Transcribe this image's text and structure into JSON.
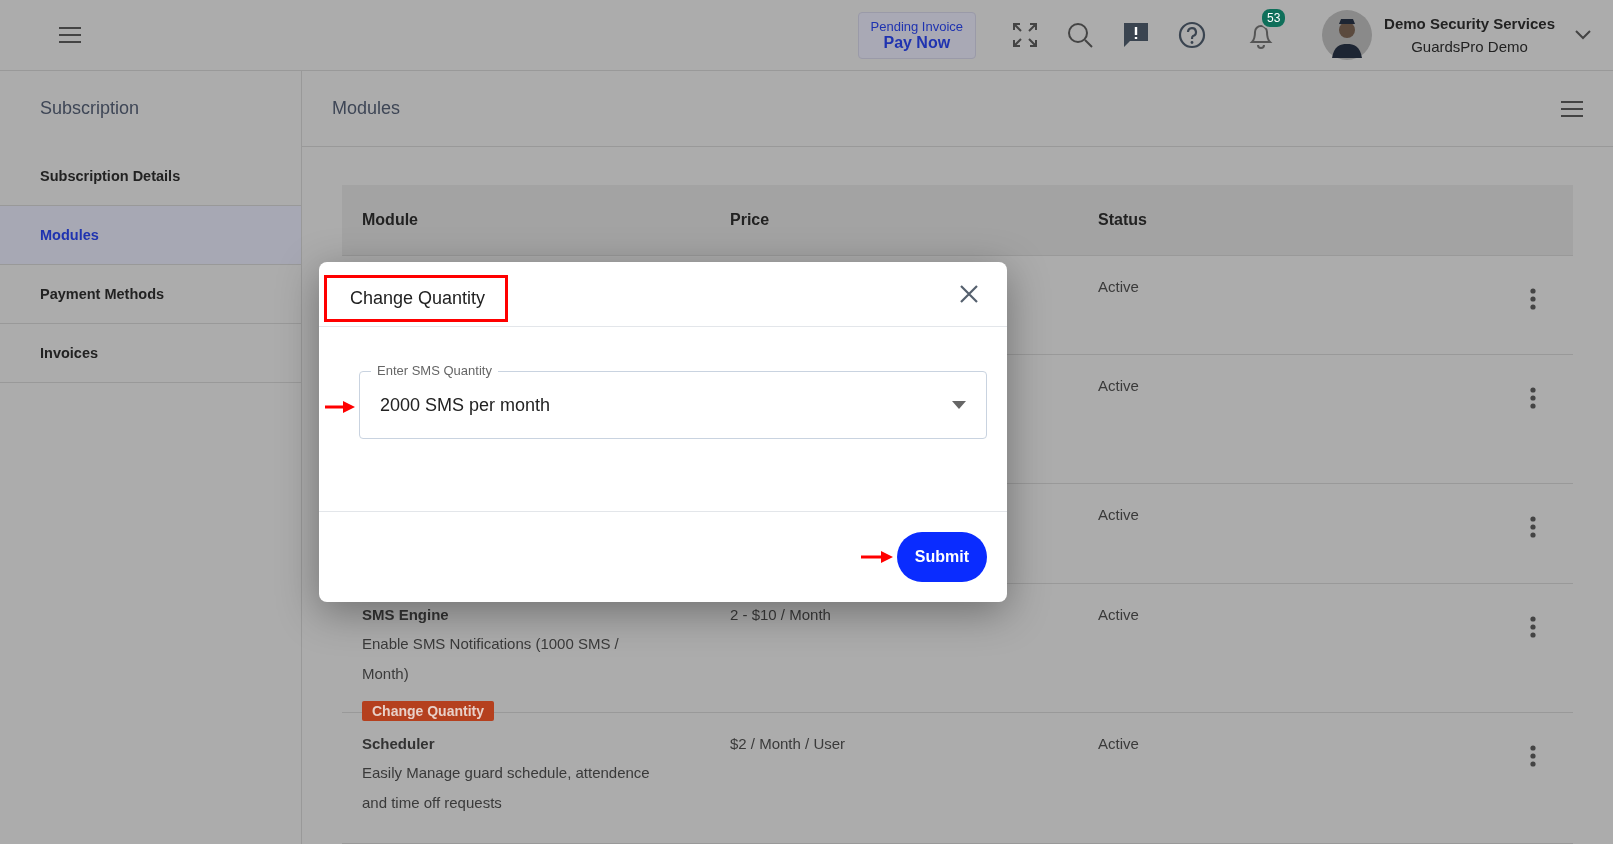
{
  "topbar": {
    "pending_invoice": {
      "label": "Pending Invoice",
      "action": "Pay Now"
    },
    "notification_count": "53",
    "user": {
      "name": "Demo Security Services",
      "company": "GuardsPro Demo"
    }
  },
  "sidebar": {
    "title": "Subscription",
    "items": [
      {
        "label": "Subscription Details",
        "selected": false
      },
      {
        "label": "Modules",
        "selected": true
      },
      {
        "label": "Payment Methods",
        "selected": false
      },
      {
        "label": "Invoices",
        "selected": false
      }
    ]
  },
  "content": {
    "title": "Modules",
    "table": {
      "columns": [
        "Module",
        "Price",
        "Status"
      ],
      "rows": [
        {
          "status": "Active"
        },
        {
          "status": "Active"
        },
        {
          "status": "Active"
        },
        {
          "module": "SMS Engine",
          "description": "Enable SMS Notifications (1000 SMS / Month)",
          "action": "Change Quantity",
          "price": "2 - $10 / Month",
          "status": "Active"
        },
        {
          "module": "Scheduler",
          "description": "Easily Manage guard schedule, attendence and time off requests",
          "price": "$2 / Month / User",
          "status": "Active"
        }
      ]
    }
  },
  "dialog": {
    "title": "Change Quantity",
    "field": {
      "label": "Enter SMS Quantity",
      "value": "2000 SMS per month"
    },
    "submit": "Submit"
  }
}
